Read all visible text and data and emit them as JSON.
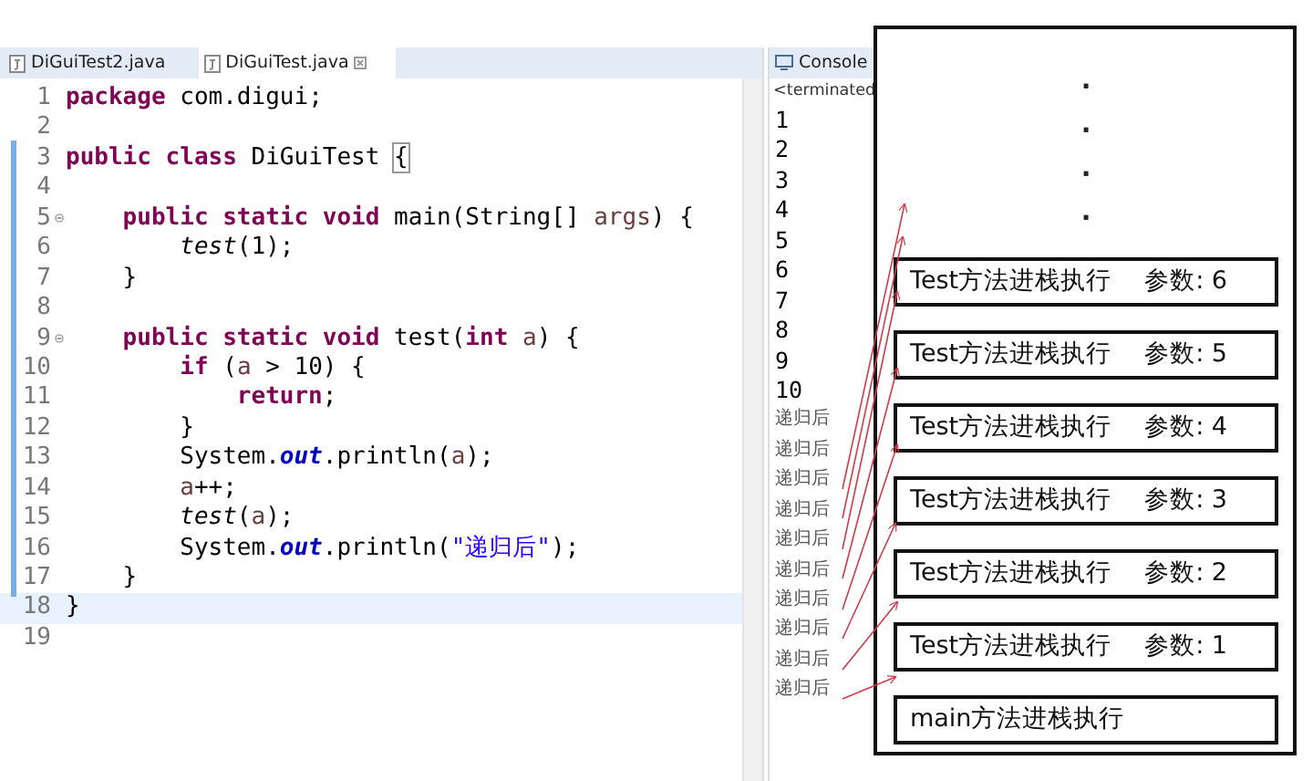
{
  "editor": {
    "tabs": [
      {
        "label": "DiGuiTest2.java",
        "selected": false
      },
      {
        "label": "DiGuiTest.java",
        "selected": true
      }
    ],
    "lines": [
      {
        "number": "1",
        "tokens": [
          {
            "kind": "keyword",
            "text": "package"
          },
          {
            "kind": "plain",
            "text": " com.digui;"
          }
        ]
      },
      {
        "number": "2"
      },
      {
        "number": "3",
        "tokens": [
          {
            "kind": "keyword",
            "text": "public "
          },
          {
            "kind": "keyword",
            "text": "class "
          },
          {
            "kind": "plain",
            "text": "DiGuiTest "
          },
          {
            "kind": "bracket_match",
            "text": "{"
          }
        ]
      },
      {
        "number": "4"
      },
      {
        "number": "5",
        "foldable": true,
        "tokens": [
          {
            "kind": "keyword",
            "text": "    public "
          },
          {
            "kind": "keyword",
            "text": "static "
          },
          {
            "kind": "keyword",
            "text": "void "
          },
          {
            "kind": "plain",
            "text": "main(String[] "
          },
          {
            "kind": "variable",
            "text": "args"
          },
          {
            "kind": "plain",
            "text": ") {"
          }
        ]
      },
      {
        "number": "6",
        "tokens": [
          {
            "kind": "call",
            "text": "        test"
          },
          {
            "kind": "plain",
            "text": "(1);"
          }
        ]
      },
      {
        "number": "7",
        "tokens": [
          {
            "kind": "plain",
            "text": "    }"
          }
        ]
      },
      {
        "number": "8"
      },
      {
        "number": "9",
        "foldable": true,
        "tokens": [
          {
            "kind": "keyword",
            "text": "    public "
          },
          {
            "kind": "keyword",
            "text": "static "
          },
          {
            "kind": "keyword",
            "text": "void "
          },
          {
            "kind": "plain",
            "text": "test("
          },
          {
            "kind": "keyword",
            "text": "int "
          },
          {
            "kind": "variable",
            "text": "a"
          },
          {
            "kind": "plain",
            "text": ") {"
          }
        ]
      },
      {
        "number": "10",
        "tokens": [
          {
            "kind": "keyword",
            "text": "        if"
          },
          {
            "kind": "plain",
            "text": " ("
          },
          {
            "kind": "variable",
            "text": "a"
          },
          {
            "kind": "plain",
            "text": " > 10) {"
          }
        ]
      },
      {
        "number": "11",
        "tokens": [
          {
            "kind": "keyword",
            "text": "            return"
          },
          {
            "kind": "plain",
            "text": ";"
          }
        ]
      },
      {
        "number": "12",
        "tokens": [
          {
            "kind": "plain",
            "text": "        }"
          }
        ]
      },
      {
        "number": "13",
        "tokens": [
          {
            "kind": "plain",
            "text": "        System."
          },
          {
            "kind": "field",
            "text": "out"
          },
          {
            "kind": "plain",
            "text": ".println("
          },
          {
            "kind": "variable",
            "text": "a"
          },
          {
            "kind": "plain",
            "text": ");"
          }
        ]
      },
      {
        "number": "14",
        "tokens": [
          {
            "kind": "variable",
            "text": "        a"
          },
          {
            "kind": "plain",
            "text": "++;"
          }
        ]
      },
      {
        "number": "15",
        "tokens": [
          {
            "kind": "call",
            "text": "        test"
          },
          {
            "kind": "plain",
            "text": "("
          },
          {
            "kind": "variable",
            "text": "a"
          },
          {
            "kind": "plain",
            "text": ");"
          }
        ]
      },
      {
        "number": "16",
        "tokens": [
          {
            "kind": "plain",
            "text": "        System."
          },
          {
            "kind": "field",
            "text": "out"
          },
          {
            "kind": "plain",
            "text": ".println("
          },
          {
            "kind": "string",
            "text": "\"递归后\""
          },
          {
            "kind": "plain",
            "text": ");"
          }
        ]
      },
      {
        "number": "17",
        "tokens": [
          {
            "kind": "plain",
            "text": "    }"
          }
        ]
      },
      {
        "number": "18",
        "current": true,
        "tokens": [
          {
            "kind": "plain",
            "text": "}"
          }
        ]
      },
      {
        "number": "19"
      }
    ]
  },
  "console": {
    "title": "Console",
    "status": "<terminated",
    "output": [
      {
        "kind": "number",
        "text": "1"
      },
      {
        "kind": "number",
        "text": "2"
      },
      {
        "kind": "number",
        "text": "3"
      },
      {
        "kind": "number",
        "text": "4"
      },
      {
        "kind": "number",
        "text": "5"
      },
      {
        "kind": "number",
        "text": "6"
      },
      {
        "kind": "number",
        "text": "7"
      },
      {
        "kind": "number",
        "text": "8"
      },
      {
        "kind": "number",
        "text": "9"
      },
      {
        "kind": "number",
        "text": "10"
      },
      {
        "kind": "message",
        "text": "递归后"
      },
      {
        "kind": "message",
        "text": "递归后"
      },
      {
        "kind": "message",
        "text": "递归后"
      },
      {
        "kind": "message",
        "text": "递归后"
      },
      {
        "kind": "message",
        "text": "递归后"
      },
      {
        "kind": "message",
        "text": "递归后"
      },
      {
        "kind": "message",
        "text": "递归后"
      },
      {
        "kind": "message",
        "text": "递归后"
      },
      {
        "kind": "message",
        "text": "递归后"
      },
      {
        "kind": "message",
        "text": "递归后"
      }
    ]
  },
  "stack_diagram": {
    "ellipsis": [
      "·",
      "·",
      "·",
      "·"
    ],
    "frames": [
      {
        "label": "Test方法进栈执行",
        "param": "参数: 6"
      },
      {
        "label": "Test方法进栈执行",
        "param": "参数: 5"
      },
      {
        "label": "Test方法进栈执行",
        "param": "参数: 4"
      },
      {
        "label": "Test方法进栈执行",
        "param": "参数: 3"
      },
      {
        "label": "Test方法进栈执行",
        "param": "参数: 2"
      },
      {
        "label": "Test方法进栈执行",
        "param": "参数: 1"
      },
      {
        "label": "main方法进栈执行"
      }
    ]
  }
}
